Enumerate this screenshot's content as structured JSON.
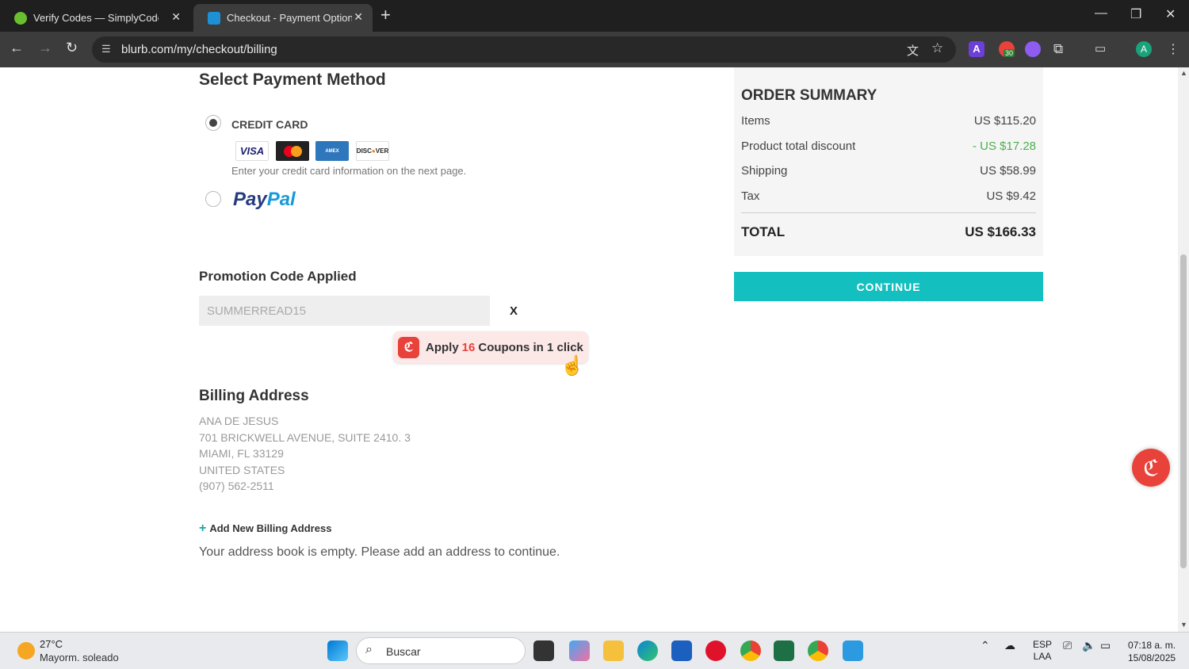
{
  "browser": {
    "tabs": [
      {
        "title": "Verify Codes — SimplyCodes",
        "active": false
      },
      {
        "title": "Checkout - Payment Options | Blurb",
        "active": true
      }
    ],
    "url": "blurb.com/my/checkout/billing",
    "extension_badge": "30",
    "profile_initial": "A"
  },
  "payment": {
    "heading": "Select Payment Method",
    "credit_card_label": "CREDIT CARD",
    "credit_card_note": "Enter your credit card information on the next page.",
    "cards": [
      "VISA",
      "MasterCard",
      "AMERICAN EXPRESS",
      "DISCOVER"
    ],
    "paypal_pay": "Pay",
    "paypal_pal": "Pal",
    "selected": "credit_card"
  },
  "promo": {
    "heading": "Promotion Code Applied",
    "code": "SUMMERREAD15",
    "remove_label": "X"
  },
  "coupon_popup": {
    "prefix": "Apply",
    "count": "16",
    "suffix": "Coupons in 1 click"
  },
  "billing": {
    "heading": "Billing Address",
    "lines": [
      "ANA DE JESUS",
      "701 BRICKWELL AVENUE, SUITE 2410. 3",
      "MIAMI, FL 33129",
      "UNITED STATES",
      "(907) 562-2511"
    ],
    "add_new_label": "Add New Billing Address",
    "empty_message": "Your address book is empty. Please add an address to continue."
  },
  "summary": {
    "title": "ORDER SUMMARY",
    "rows": [
      {
        "label": "Items",
        "value": "US $115.20"
      },
      {
        "label": "Product total discount",
        "value": "- US $17.28"
      },
      {
        "label": "Shipping",
        "value": "US $58.99"
      },
      {
        "label": "Tax",
        "value": "US $9.42"
      }
    ],
    "total_label": "TOTAL",
    "total_value": "US $166.33",
    "continue_label": "CONTINUE"
  },
  "taskbar": {
    "temperature": "27°C",
    "weather": "Mayorm. soleado",
    "search_label": "Buscar",
    "language": "ESP",
    "layout": "LAA",
    "time": "07:18 a. m.",
    "date": "15/08/2025"
  },
  "colors": {
    "accent": "#14bfbf",
    "discount": "#4caf50",
    "simplycodes": "#e8423a"
  }
}
